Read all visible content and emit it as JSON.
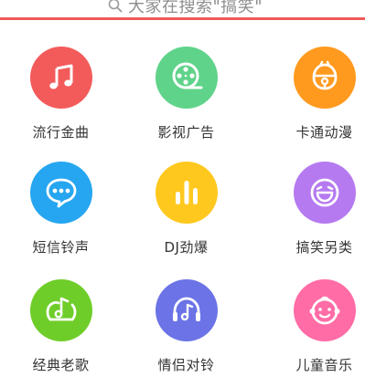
{
  "search": {
    "placeholder_text": "大家在搜索\"搞笑\""
  },
  "categories": [
    {
      "label": "流行金曲",
      "icon": "music-note-icon",
      "color": "#f35b5b"
    },
    {
      "label": "影视广告",
      "icon": "film-reel-icon",
      "color": "#5fd38a"
    },
    {
      "label": "卡通动漫",
      "icon": "bell-icon",
      "color": "#ff9a1f"
    },
    {
      "label": "短信铃声",
      "icon": "chat-bubble-icon",
      "color": "#26a6f0"
    },
    {
      "label": "DJ劲爆",
      "icon": "equalizer-icon",
      "color": "#ffc81f"
    },
    {
      "label": "搞笑另类",
      "icon": "laughing-face-icon",
      "color": "#b57af0"
    },
    {
      "label": "经典老歌",
      "icon": "record-note-icon",
      "color": "#6fcd2a"
    },
    {
      "label": "情侣对铃",
      "icon": "headphones-note-icon",
      "color": "#6b73e6"
    },
    {
      "label": "儿童音乐",
      "icon": "child-face-icon",
      "color": "#ff6ca6"
    }
  ]
}
